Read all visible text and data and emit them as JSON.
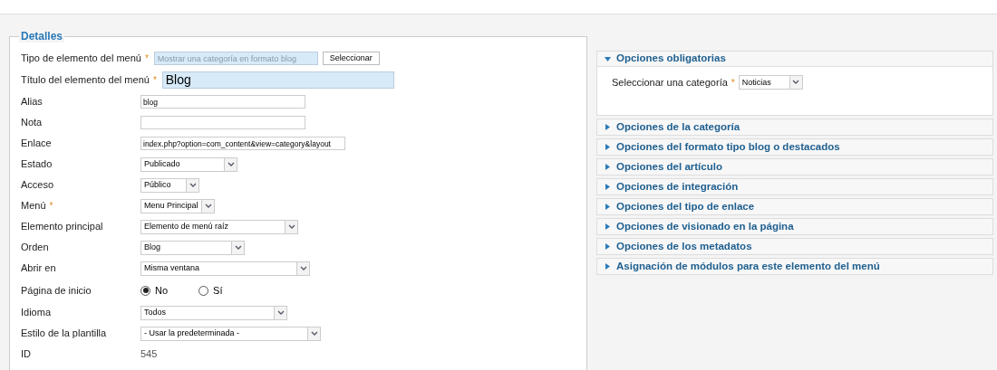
{
  "details": {
    "legend": "Detalles",
    "fields": [
      {
        "kind": "type",
        "label": "Tipo de elemento del menú",
        "required_mark": "*",
        "value": "Mostrar una categoría en formato blog",
        "button": "Seleccionar"
      },
      {
        "kind": "title",
        "label": "Título del elemento del menú",
        "required_mark": "*",
        "value": "Blog"
      },
      {
        "kind": "text",
        "label": "Alias",
        "value": "blog"
      },
      {
        "kind": "text",
        "label": "Nota"
      },
      {
        "kind": "text",
        "label": "Enlace",
        "value": "index.php?option=com_content&view=category&layout"
      },
      {
        "kind": "select",
        "label": "Estado",
        "value": "Publicado"
      },
      {
        "kind": "select",
        "label": "Acceso",
        "value": "Público"
      },
      {
        "kind": "select",
        "label": "Menú",
        "required_mark": "*",
        "value": "Menu Principal"
      },
      {
        "kind": "select",
        "label": "Elemento principal",
        "value": "Elemento de menú raíz"
      },
      {
        "kind": "select",
        "label": "Orden",
        "value": "Blog"
      },
      {
        "kind": "select",
        "label": "Abrir en",
        "value": "Misma ventana"
      },
      {
        "kind": "radio",
        "label": "Página de inicio",
        "options": [
          {
            "label": "No",
            "selected": true
          },
          {
            "label": "Sí",
            "selected": false
          }
        ]
      },
      {
        "kind": "select",
        "label": "Idioma",
        "value": "Todos"
      },
      {
        "kind": "select",
        "label": "Estilo de la plantilla",
        "value": "- Usar la predeterminada -"
      },
      {
        "kind": "static",
        "label": "ID",
        "value": "545"
      }
    ]
  },
  "panels": [
    {
      "title": "Opciones obligatorias",
      "expanded": true,
      "fields": [
        {
          "label": "Seleccionar una categoría",
          "required_mark": "*",
          "value": "Noticias"
        }
      ]
    },
    {
      "title": "Opciones de la categoría",
      "expanded": false
    },
    {
      "title": "Opciones del formato tipo blog o destacados",
      "expanded": false
    },
    {
      "title": "Opciones del artículo",
      "expanded": false
    },
    {
      "title": "Opciones de integración",
      "expanded": false
    },
    {
      "title": "Opciones del tipo de enlace",
      "expanded": false
    },
    {
      "title": "Opciones de visionado en la página",
      "expanded": false
    },
    {
      "title": "Opciones de los metadatos",
      "expanded": false
    },
    {
      "title": "Asignación de módulos para este elemento del menú",
      "expanded": false
    }
  ]
}
